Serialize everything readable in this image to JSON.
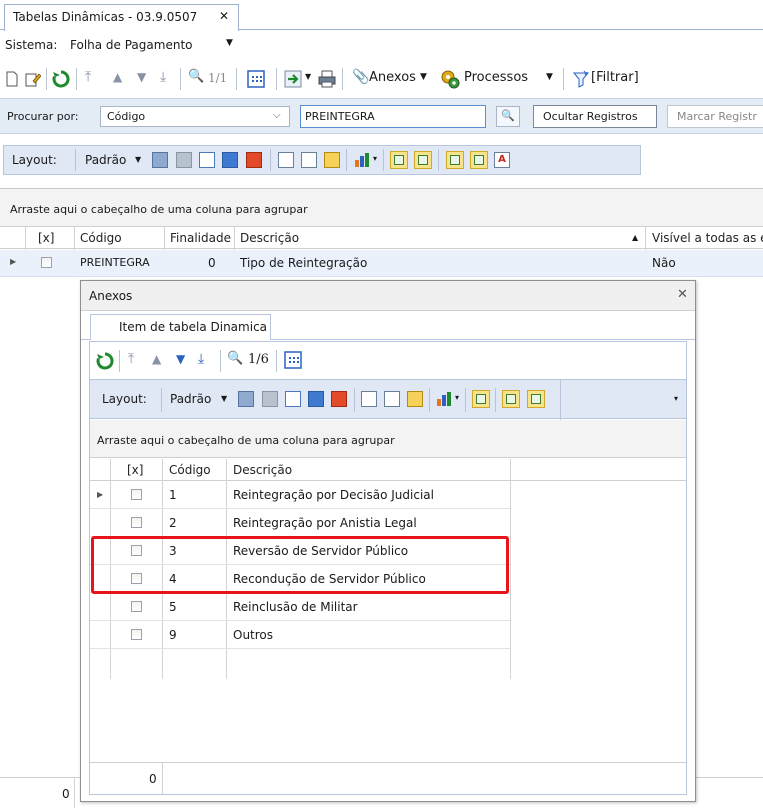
{
  "tab": {
    "title": "Tabelas Dinâmicas - 03.9.0507",
    "close": "✕"
  },
  "sistema": {
    "label": "Sistema:",
    "value": "Folha de Pagamento"
  },
  "toolbar": {
    "record_counter": "1/1",
    "anexos_label": "Anexos",
    "processos_label": "Processos",
    "filtrar_label": "[Filtrar]"
  },
  "search": {
    "label": "Procurar por:",
    "field": "Código",
    "value": "PREINTEGRA",
    "hide_button": "Ocultar Registros",
    "mark_button": "Marcar Registr"
  },
  "layout_bar": {
    "label": "Layout:",
    "preset": "Padrão"
  },
  "main_grid": {
    "group_hint": "Arraste aqui o cabeçalho de uma coluna para agrupar",
    "columns": [
      "[x]",
      "Código",
      "Finalidade",
      "Descrição",
      "Visível a todas as e"
    ],
    "rows": [
      {
        "codigo": "PREINTEGRA",
        "finalidade": "0",
        "descricao": "Tipo de Reintegração",
        "visivel": "Não"
      }
    ],
    "footer_count": "0"
  },
  "dialog": {
    "title": "Anexos",
    "close": "✕",
    "tab": "Item de tabela Dinamica",
    "record_counter": "1/6",
    "layout_label": "Layout:",
    "layout_preset": "Padrão",
    "group_hint": "Arraste aqui o cabeçalho de uma coluna para agrupar",
    "columns": [
      "[x]",
      "Código",
      "Descrição"
    ],
    "rows": [
      {
        "codigo": "1",
        "descricao": "Reintegração por Decisão Judicial"
      },
      {
        "codigo": "2",
        "descricao": "Reintegração por Anistia Legal"
      },
      {
        "codigo": "3",
        "descricao": "Reversão de Servidor Público"
      },
      {
        "codigo": "4",
        "descricao": "Recondução de Servidor Público"
      },
      {
        "codigo": "5",
        "descricao": "Reinclusão de Militar"
      },
      {
        "codigo": "9",
        "descricao": "Outros"
      }
    ],
    "footer_count": "0"
  },
  "colors": {
    "highlight": "#e8141c",
    "toolbar_bg": "#dfe8f4",
    "accent_blue": "#2b62c2"
  }
}
